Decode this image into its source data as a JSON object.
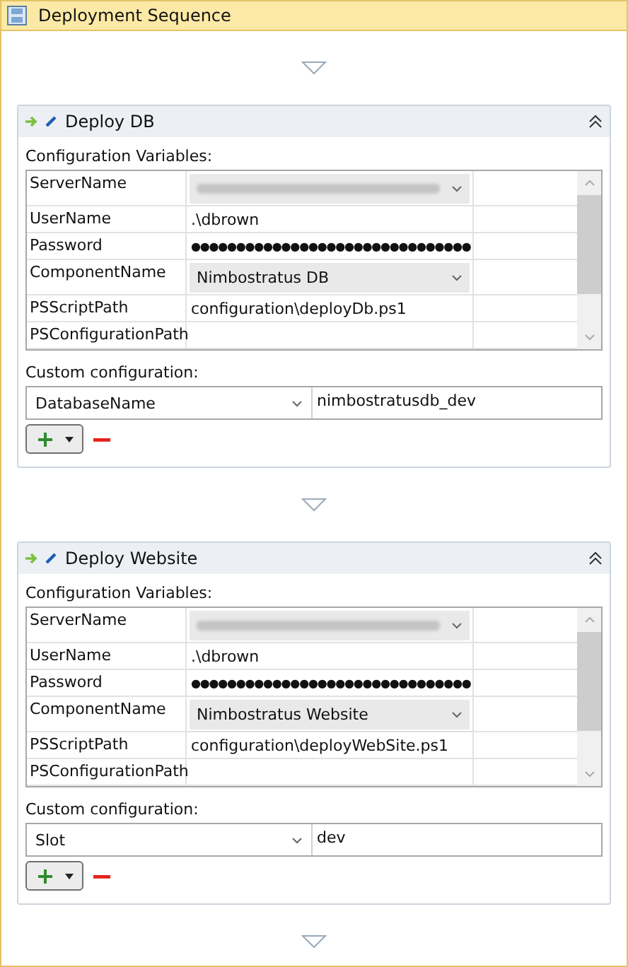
{
  "title": "Deployment Sequence",
  "steps": [
    {
      "title": "Deploy DB",
      "variables_label": "Configuration Variables:",
      "variables": [
        {
          "name": "ServerName",
          "kind": "blurred"
        },
        {
          "name": "UserName",
          "kind": "text",
          "value": ".\\dbrown"
        },
        {
          "name": "Password",
          "kind": "password",
          "value": "●●●●●●●●●●●●●●●●●●●●●●●●●●●●●●●"
        },
        {
          "name": "ComponentName",
          "kind": "dropdown",
          "value": "Nimbostratus DB"
        },
        {
          "name": "PSScriptPath",
          "kind": "text",
          "value": "configuration\\deployDb.ps1"
        },
        {
          "name": "PSConfigurationPath",
          "kind": "empty"
        }
      ],
      "custom_label": "Custom configuration:",
      "custom": [
        {
          "key": "DatabaseName",
          "value": "nimbostratusdb_dev"
        }
      ]
    },
    {
      "title": "Deploy Website",
      "variables_label": "Configuration Variables:",
      "variables": [
        {
          "name": "ServerName",
          "kind": "blurred"
        },
        {
          "name": "UserName",
          "kind": "text",
          "value": ".\\dbrown"
        },
        {
          "name": "Password",
          "kind": "password",
          "value": "●●●●●●●●●●●●●●●●●●●●●●●●●●●●●●●"
        },
        {
          "name": "ComponentName",
          "kind": "dropdown",
          "value": "Nimbostratus Website"
        },
        {
          "name": "PSScriptPath",
          "kind": "text",
          "value": "configuration\\deployWebSite.ps1"
        },
        {
          "name": "PSConfigurationPath",
          "kind": "empty"
        }
      ],
      "custom_label": "Custom configuration:",
      "custom": [
        {
          "key": "Slot",
          "value": "dev"
        }
      ]
    }
  ]
}
